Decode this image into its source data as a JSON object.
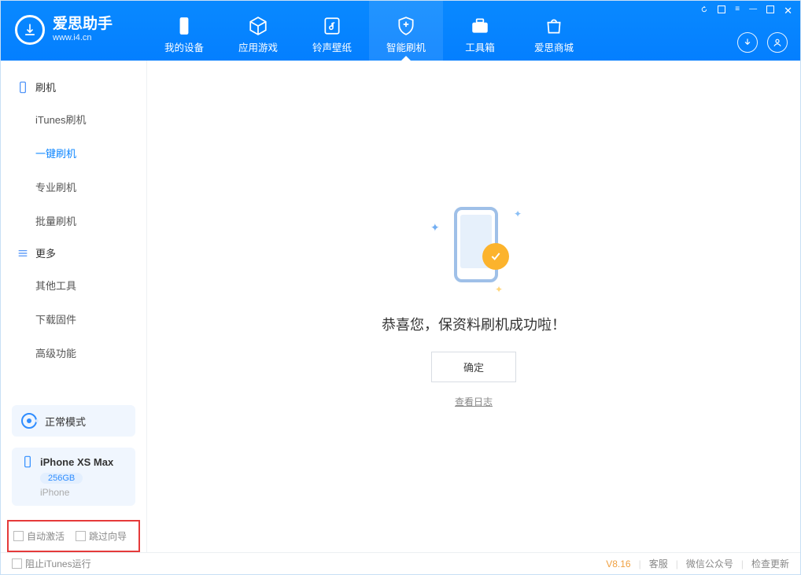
{
  "app": {
    "name": "爱思助手",
    "url": "www.i4.cn"
  },
  "tabs": {
    "device": "我的设备",
    "apps": "应用游戏",
    "ring": "铃声壁纸",
    "flash": "智能刷机",
    "tool": "工具箱",
    "store": "爱思商城"
  },
  "sidebar": {
    "cat_flash": "刷机",
    "items_flash": {
      "itunes": "iTunes刷机",
      "oneclick": "一键刷机",
      "pro": "专业刷机",
      "batch": "批量刷机"
    },
    "cat_more": "更多",
    "items_more": {
      "other": "其他工具",
      "firmware": "下载固件",
      "adv": "高级功能"
    }
  },
  "mode": {
    "label": "正常模式"
  },
  "device": {
    "name": "iPhone XS Max",
    "capacity": "256GB",
    "type": "iPhone"
  },
  "options": {
    "auto_activate": "自动激活",
    "skip_guide": "跳过向导"
  },
  "main": {
    "message": "恭喜您，保资料刷机成功啦！",
    "confirm": "确定",
    "view_log": "查看日志"
  },
  "status": {
    "block_itunes": "阻止iTunes运行",
    "version": "V8.16",
    "service": "客服",
    "wechat": "微信公众号",
    "update": "检查更新"
  }
}
